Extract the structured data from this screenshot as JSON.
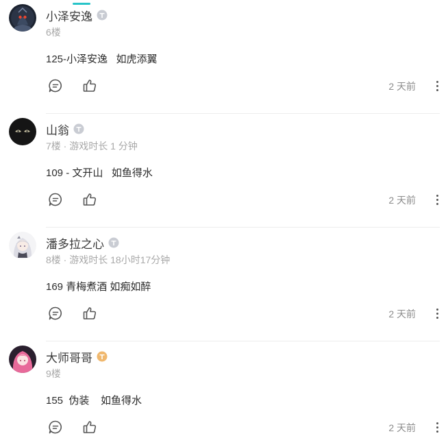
{
  "comments": [
    {
      "username": "小泽安逸",
      "meta": "6楼",
      "content": "125-小泽安逸   如虎添翼",
      "time": "2 天前",
      "badge": "gray",
      "avatar": "dark-robot-avatar"
    },
    {
      "username": "山翁",
      "meta": "7楼 · 游戏时长 1 分钟",
      "content": "109 - 文开山   如鱼得水",
      "time": "2 天前",
      "badge": "gray",
      "avatar": "dark-eyes-avatar"
    },
    {
      "username": "潘多拉之心",
      "meta": "8楼 · 游戏时长 18小时17分钟",
      "content": "169 青梅煮酒 如痴如醉",
      "time": "2 天前",
      "badge": "gray",
      "avatar": "white-hair-girl-avatar"
    },
    {
      "username": "大师哥哥",
      "meta": "9楼",
      "content": "155  伪装    如鱼得水",
      "time": "2 天前",
      "badge": "gold",
      "avatar": "pink-hair-girl-avatar"
    }
  ],
  "colors": {
    "accent": "#27c4c8",
    "badge_gray": "#c9ccd3",
    "badge_gold": "#f0b86e",
    "meta_text": "#a8a8a8",
    "divider": "#ececec"
  },
  "icons": {
    "reply": "comment-bubble-icon",
    "like": "thumbs-up-icon",
    "more": "more-vertical-icon"
  }
}
